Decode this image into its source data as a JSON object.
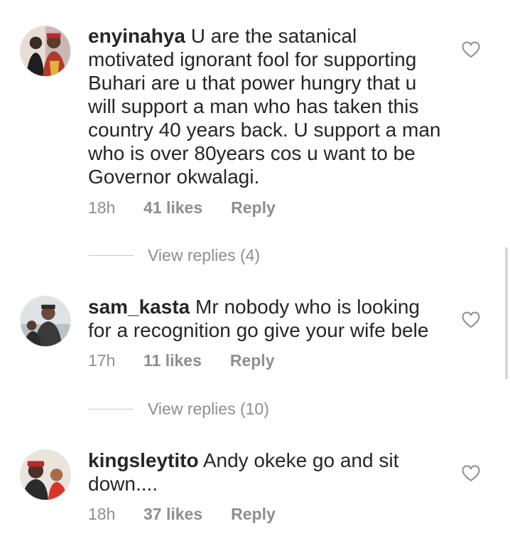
{
  "comments": [
    {
      "username": "enyinahya",
      "text": "U are the satanical motivated ignorant fool for supporting Buhari are u that power hungry that u will support a man who has taken this country 40 years back. U support a man who is over 80years cos u want to be Governor okwalagi.",
      "time": "18h",
      "likes": "41 likes",
      "reply_label": "Reply",
      "view_replies": "View replies (4)"
    },
    {
      "username": "sam_kasta",
      "text": "Mr nobody who is looking for a recognition go give your wife bele",
      "time": "17h",
      "likes": "11 likes",
      "reply_label": "Reply",
      "view_replies": "View replies (10)"
    },
    {
      "username": "kingsleytito",
      "text": "Andy okeke go and sit down....",
      "time": "18h",
      "likes": "37 likes",
      "reply_label": "Reply"
    }
  ],
  "icons": {
    "like": "heart-outline-icon",
    "avatar": "avatar-photo"
  },
  "colors": {
    "text": "#262626",
    "muted": "#8e8e8e",
    "divider": "#c7c7c7"
  }
}
